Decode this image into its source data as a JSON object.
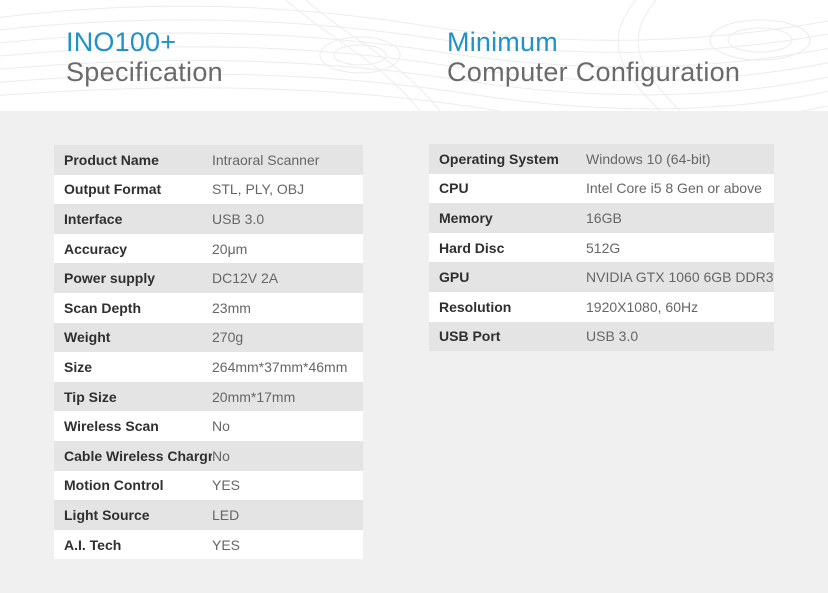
{
  "left_heading": {
    "title": "INO100+",
    "subtitle": "Specification"
  },
  "right_heading": {
    "title": "Minimum",
    "subtitle": "Computer Configuration"
  },
  "product_specs": [
    {
      "label": "Product Name",
      "value": "Intraoral Scanner"
    },
    {
      "label": "Output Format",
      "value": "STL, PLY, OBJ"
    },
    {
      "label": "Interface",
      "value": "USB 3.0"
    },
    {
      "label": "Accuracy",
      "value": "20μm"
    },
    {
      "label": "Power supply",
      "value": "DC12V 2A"
    },
    {
      "label": "Scan Depth",
      "value": "23mm"
    },
    {
      "label": "Weight",
      "value": "270g"
    },
    {
      "label": "Size",
      "value": "264mm*37mm*46mm"
    },
    {
      "label": "Tip Size",
      "value": "20mm*17mm"
    },
    {
      "label": "Wireless Scan",
      "value": "No"
    },
    {
      "label": "Cable Wireless Chargre",
      "value": "No"
    },
    {
      "label": "Motion Control",
      "value": "YES"
    },
    {
      "label": "Light Source",
      "value": "LED"
    },
    {
      "label": "A.I. Tech",
      "value": "YES"
    }
  ],
  "computer_config": [
    {
      "label": "Operating System",
      "value": "Windows 10 (64-bit)"
    },
    {
      "label": "CPU",
      "value": "Intel Core i5 8 Gen or above"
    },
    {
      "label": "Memory",
      "value": "16GB"
    },
    {
      "label": "Hard Disc",
      "value": "512G"
    },
    {
      "label": "GPU",
      "value": "NVIDIA GTX 1060 6GB DDR3"
    },
    {
      "label": "Resolution",
      "value": "1920X1080, 60Hz"
    },
    {
      "label": "USB Port",
      "value": "USB 3.0"
    }
  ],
  "colors": {
    "accent": "#2192c5",
    "subtitle": "#6a6a6a",
    "row_shaded": "#e4e4e4",
    "row_plain": "#ffffff",
    "page_background": "#f0f0f0"
  }
}
